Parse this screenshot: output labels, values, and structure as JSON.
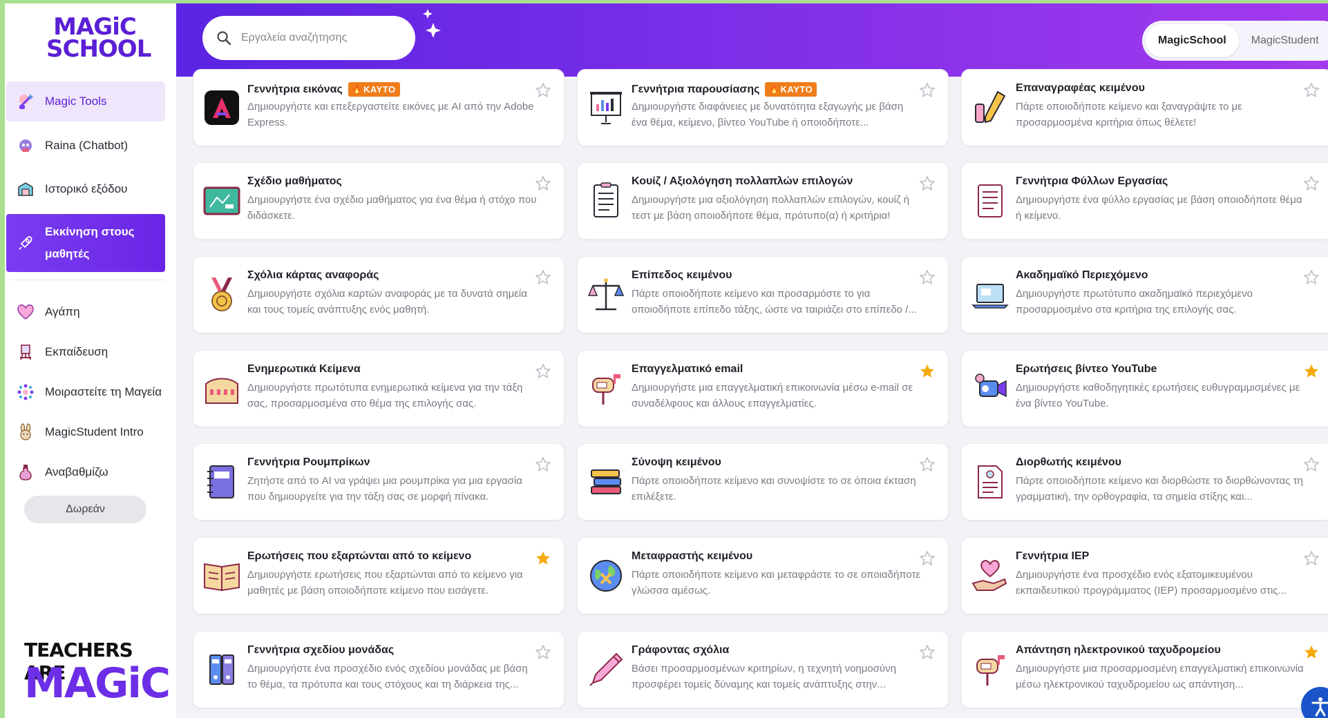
{
  "brand": {
    "logo_top_line1": "MAGiC",
    "logo_top_line2": "SCHOOL",
    "logo_bottom_line1": "TEACHERS ARE",
    "logo_bottom_line2": "MAGiC"
  },
  "sidebar": {
    "items": [
      {
        "label": "Magic Tools",
        "icon": "sparkle-tools-icon"
      },
      {
        "label": "Raina (Chatbot)",
        "icon": "robot-icon"
      },
      {
        "label": "Ιστορικό εξόδου",
        "icon": "history-box-icon"
      },
      {
        "label": "Εκκίνηση στους μαθητές",
        "icon": "rocket-icon"
      },
      {
        "label": "Αγάπη",
        "icon": "heart-icon"
      },
      {
        "label": "Εκπαίδευση",
        "icon": "easel-icon"
      },
      {
        "label": "Μοιραστείτε τη Μαγεία",
        "icon": "share-icon"
      },
      {
        "label": "MagicStudent Intro",
        "icon": "bunny-icon"
      },
      {
        "label": "Αναβαθμίζω",
        "icon": "potion-icon"
      }
    ],
    "free_label": "Δωρεάν"
  },
  "header": {
    "search_placeholder": "Εργαλεία αναζήτησης",
    "toggle": {
      "active": "MagicSchool",
      "inactive": "MagicStudent"
    }
  },
  "colors": {
    "accent": "#6a25e6",
    "badge": "#ef7d1a",
    "star_on": "#f5a90a",
    "star_off": "#bdbdc6"
  },
  "cards": [
    {
      "title": "Γεννήτρια εικόνας",
      "badge": "ΚΑΥΤΟ",
      "desc": "Δημιουργήστε και επεξεργαστείτε εικόνες με AI από την Adobe Express.",
      "starred": false,
      "icon": "adobe-icon"
    },
    {
      "title": "Γεννήτρια παρουσίασης",
      "badge": "ΚΑΥΤΟ",
      "desc": "Δημιουργήστε διαφάνειες με δυνατότητα εξαγωγής με βάση ένα θέμα, κείμενο, βίντεο YouTube ή οποιοδήποτε...",
      "starred": false,
      "icon": "presentation-icon"
    },
    {
      "title": "Επαναγραφέας κειμένου",
      "badge": "",
      "desc": "Πάρτε οποιοδήποτε κείμενο και ξαναγράψτε το με προσαρμοσμένα κριτήρια όπως θέλετε!",
      "starred": false,
      "icon": "pencil-eraser-icon"
    },
    {
      "title": "Σχέδιο μαθήματος",
      "badge": "",
      "desc": "Δημιουργήστε ένα σχέδιο μαθήματος για ένα θέμα ή στόχο που διδάσκετε.",
      "starred": false,
      "icon": "chalkboard-icon"
    },
    {
      "title": "Κουίζ / Αξιολόγηση πολλαπλών επιλογών",
      "badge": "",
      "desc": "Δημιουργήστε μια αξιολόγηση πολλαπλών επιλογών, κουίζ ή τεστ με βάση οποιοδήποτε θέμα, πρότυπο(α) ή κριτήρια!",
      "starred": false,
      "icon": "checklist-icon"
    },
    {
      "title": "Γεννήτρια Φύλλων Εργασίας",
      "badge": "",
      "desc": "Δημιουργήστε ένα φύλλο εργασίας με βάση οποιοδήποτε θέμα ή κείμενο.",
      "starred": false,
      "icon": "worksheet-icon"
    },
    {
      "title": "Σχόλια κάρτας αναφοράς",
      "badge": "",
      "desc": "Δημιουργήστε σχόλια καρτών αναφοράς με τα δυνατά σημεία και τους τομείς ανάπτυξης ενός μαθητή.",
      "starred": false,
      "icon": "medal-icon"
    },
    {
      "title": "Επίπεδος κειμένου",
      "badge": "",
      "desc": "Πάρτε οποιοδήποτε κείμενο και προσαρμόστε το για οποιοδήποτε επίπεδο τάξης, ώστε να ταιριάζει στο επίπεδο /...",
      "starred": false,
      "icon": "scales-icon"
    },
    {
      "title": "Ακαδημαϊκό Περιεχόμενο",
      "badge": "",
      "desc": "Δημιουργήστε πρωτότυπο ακαδημαϊκό περιεχόμενο προσαρμοσμένο στα κριτήρια της επιλογής σας.",
      "starred": false,
      "icon": "laptop-icon"
    },
    {
      "title": "Ενημερωτικά Κείμενα",
      "badge": "",
      "desc": "Δημιουργήστε πρωτότυπα ενημερωτικά κείμενα για την τάξη σας, προσαρμοσμένα στο θέμα της επιλογής σας.",
      "starred": false,
      "icon": "colosseum-icon"
    },
    {
      "title": "Επαγγελματικό email",
      "badge": "",
      "desc": "Δημιουργήστε μια επαγγελματική επικοινωνία μέσω e-mail σε συναδέλφους και άλλους επαγγελματίες.",
      "starred": true,
      "icon": "mailbox-icon"
    },
    {
      "title": "Ερωτήσεις βίντεο YouTube",
      "badge": "",
      "desc": "Δημιουργήστε καθοδηγητικές ερωτήσεις ευθυγραμμισμένες με ένα βίντεο YouTube.",
      "starred": true,
      "icon": "video-camera-icon"
    },
    {
      "title": "Γεννήτρια Ρουμπρίκων",
      "badge": "",
      "desc": "Ζητήστε από το AI να γράψει μια ρουμπρίκα για μια εργασία που δημιουργείτε για την τάξη σας σε μορφή πίνακα.",
      "starred": false,
      "icon": "notebook-icon"
    },
    {
      "title": "Σύνοψη κειμένου",
      "badge": "",
      "desc": "Πάρτε οποιοδήποτε κείμενο και συνοψίστε το σε όποια έκταση επιλέξετε.",
      "starred": false,
      "icon": "books-stack-icon"
    },
    {
      "title": "Διορθωτής κειμένου",
      "badge": "",
      "desc": "Πάρτε οποιοδήποτε κείμενο και διορθώστε το διορθώνοντας τη γραμματική, την ορθογραφία, τα σημεία στίξης και...",
      "starred": false,
      "icon": "document-icon"
    },
    {
      "title": "Ερωτήσεις που εξαρτώνται από το κείμενο",
      "badge": "",
      "desc": "Δημιουργήστε ερωτήσεις που εξαρτώνται από το κείμενο για μαθητές με βάση οποιοδήποτε κείμενο που εισάγετε.",
      "starred": true,
      "icon": "open-book-icon"
    },
    {
      "title": "Μεταφραστής κειμένου",
      "badge": "",
      "desc": "Πάρτε οποιοδήποτε κείμενο και μεταφράστε το σε οποιαδήποτε γλώσσα αμέσως.",
      "starred": false,
      "icon": "globe-icon"
    },
    {
      "title": "Γεννήτρια IEP",
      "badge": "",
      "desc": "Δημιουργήστε ένα προσχέδιο ενός εξατομικευμένου εκπαιδευτικού προγράμματος (IEP) προσαρμοσμένο στις...",
      "starred": false,
      "icon": "heart-hand-icon"
    },
    {
      "title": "Γεννήτρια σχεδίου μονάδας",
      "badge": "",
      "desc": "Δημιουργήστε ένα προσχέδιο ενός σχεδίου μονάδας με βάση το θέμα, τα πρότυπα και τους στόχους και τη διάρκεια της...",
      "starred": false,
      "icon": "binders-icon"
    },
    {
      "title": "Γράφοντας σχόλια",
      "badge": "",
      "desc": "Βάσει προσαρμοσμένων κριτηρίων, η τεχνητή νοημοσύνη προσφέρει τομείς δύναμης και τομείς ανάπτυξης στην...",
      "starred": false,
      "icon": "pen-icon"
    },
    {
      "title": "Απάντηση ηλεκτρονικού ταχυδρομείου",
      "badge": "",
      "desc": "Δημιουργήστε μια προσαρμοσμένη επαγγελματική επικοινωνία μέσω ηλεκτρονικού ταχυδρομείου ως απάντηση...",
      "starred": true,
      "icon": "mailbox-icon"
    }
  ]
}
